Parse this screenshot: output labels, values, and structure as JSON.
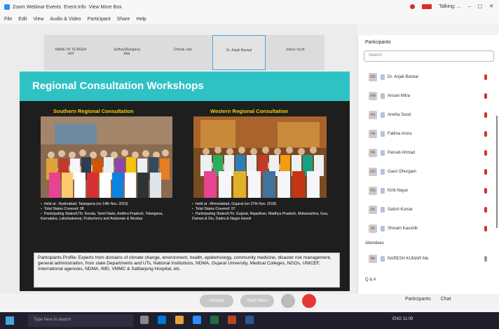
{
  "window": {
    "title": "Zoom Webinar Events",
    "tabs": [
      "Event Info",
      "View More Box"
    ],
    "user_label": "Talking: ...",
    "controls": [
      "–",
      "▢",
      "✕"
    ]
  },
  "menu": [
    "File",
    "Edit",
    "View",
    "Audio & Video",
    "Participant",
    "Share",
    "Help"
  ],
  "thumbs": [
    {
      "name": "NAME OF SCREEN",
      "sub": "A/H"
    },
    {
      "name": "Jadhav(Rangara)",
      "sub": "Attd"
    },
    {
      "name": "Chitrak Jain"
    },
    {
      "name": "Dr. Anjali Barwal",
      "active": true
    },
    {
      "name": "Janice Scott"
    }
  ],
  "slide": {
    "title": "Regional Consultation Workshops",
    "left": {
      "subtitle": "Southern Regional Consultation",
      "bullets": [
        "Held at : Hyderabad, Telangana (on 14th Nov. 2019)",
        "Total States Covered: 08",
        "Participating States/UTs: Kerala, Tamil Nadu, Andhra Pradesh, Telangana, Karnataka, Lakshadweep, Puducherry and Andaman & Nicobar"
      ]
    },
    "right": {
      "subtitle": "Western Regional Consultation",
      "bullets": [
        "Held at : Ahmedabad, Gujarat (on 27th Nov. 2019)",
        "Total States Covered: 07",
        "Participating States/UTs: Gujarat, Rajasthan, Madhya Pradesh, Maharashtra, Goa, Daman & Diu, Dadra & Nagar Haveli"
      ]
    },
    "note": "Participants Profile: Experts from domains of climate change, environment, health, epidemiology, community medicine, disaster risk management, general administration, from state Departments and UTs, National Institutions, NDMA, Gujarat University, Medical Colleges, NGOs, UNICEF, International agencies, NDMA, IMD, VMMC & Safdarjung Hospital, etc."
  },
  "controls": {
    "mute": "Unmute",
    "video": "Start Video"
  },
  "participants": {
    "header": "Participants",
    "search_placeholder": "Search",
    "items": [
      {
        "initials": "DR",
        "name": "Dr. Anjali Barwal"
      },
      {
        "initials": "AM",
        "name": "Ansari Mitra"
      },
      {
        "initials": "AS",
        "name": "Aneha Sood"
      },
      {
        "initials": "FA",
        "name": "Fatima Arora"
      },
      {
        "initials": "PA",
        "name": "Parvati Ahmad"
      },
      {
        "initials": "GD",
        "name": "Gauri Dhurgam"
      },
      {
        "initials": "KN",
        "name": "Kiriti Nayar"
      },
      {
        "initials": "SK",
        "name": "Satish Kumar"
      },
      {
        "initials": "SK",
        "name": "Shivam Kaushik"
      }
    ],
    "attendee_section": "Attendees",
    "attendees": [
      {
        "initials": "NK",
        "name": "NARESH KUMAR",
        "sub": "Me"
      }
    ],
    "qa": "Q & A"
  },
  "bottom": {
    "participants": "Participants",
    "chat": "Chat"
  },
  "taskbar": {
    "search": "Type here to search",
    "tray": "ENG 11:09"
  },
  "colors": {
    "teal": "#2fc2c4",
    "yellow": "#f5d100",
    "end_red": "#e53935"
  }
}
